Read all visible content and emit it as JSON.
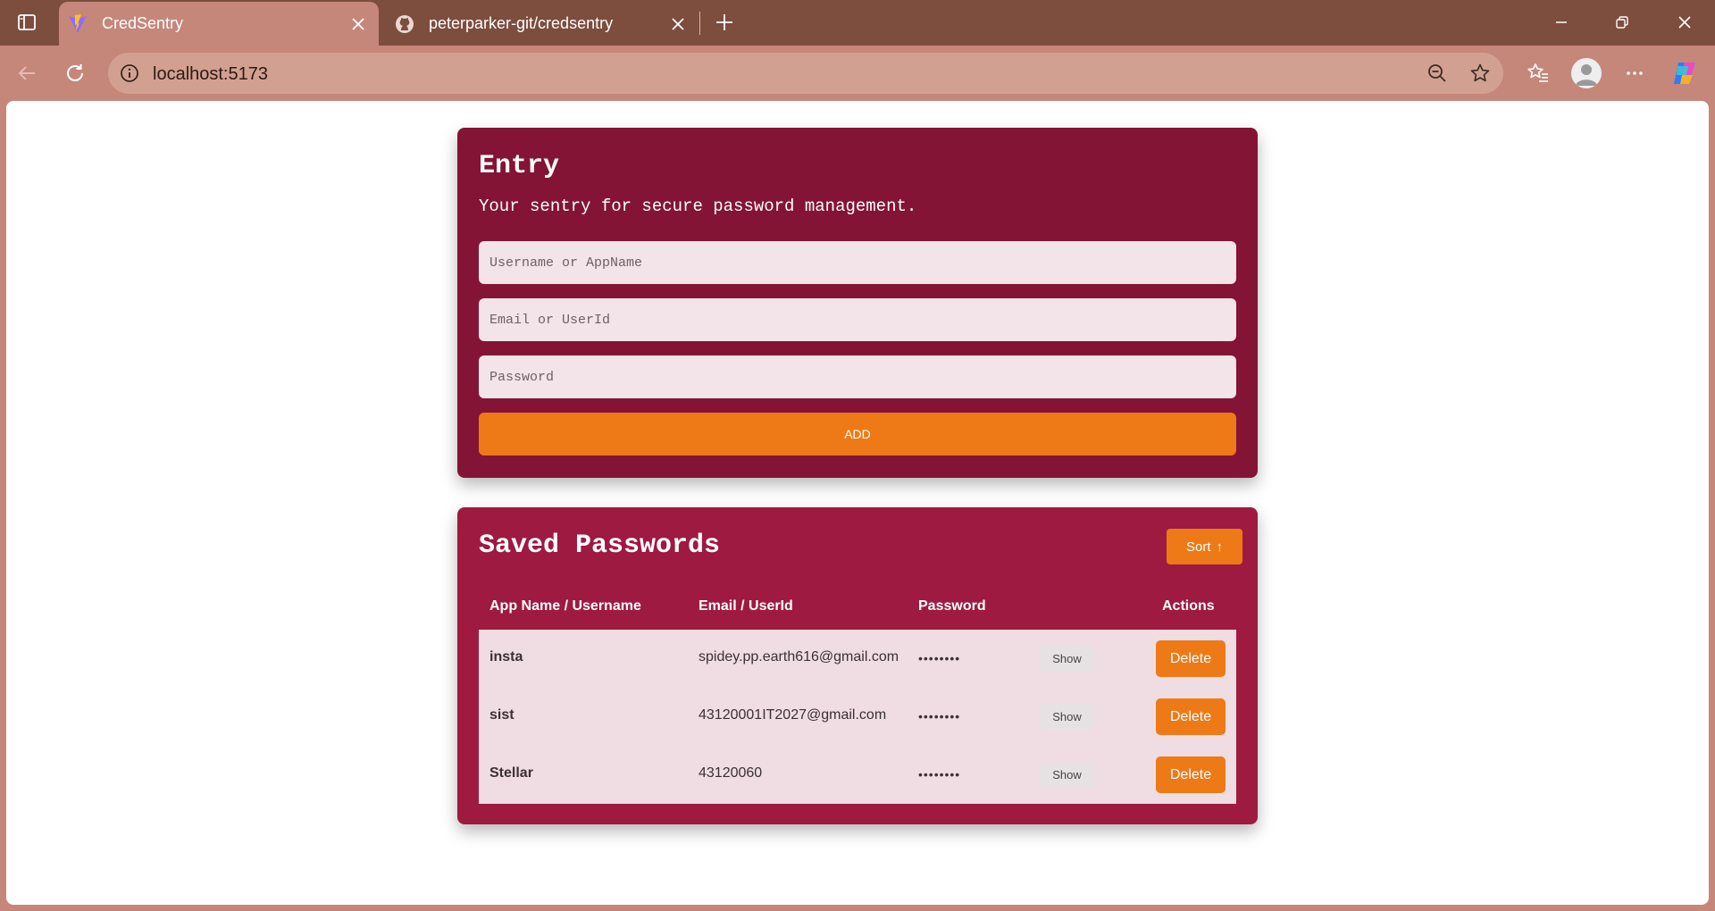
{
  "browser": {
    "tabs": [
      {
        "title": "CredSentry",
        "active": true,
        "favicon": "vite-logo-icon"
      },
      {
        "title": "peterparker-git/credsentry",
        "active": false,
        "favicon": "github-icon"
      }
    ],
    "address": "localhost:5173",
    "theme_colors": {
      "tabbar": "#7d4d3d",
      "toolbar": "#c5877a",
      "omnibox": "#d2a090"
    }
  },
  "entry": {
    "title": "Entry",
    "tagline": "Your sentry for secure password management.",
    "username_placeholder": "Username or AppName",
    "email_placeholder": "Email or UserId",
    "password_placeholder": "Password",
    "add_label": "ADD"
  },
  "saved": {
    "title": "Saved Passwords",
    "sort_label": "Sort",
    "sort_arrow": "↑",
    "headers": {
      "app": "App Name / Username",
      "email": "Email / UserId",
      "password": "Password",
      "actions": "Actions"
    },
    "rows": [
      {
        "app": "insta",
        "email": "spidey.pp.earth616@gmail.com",
        "password_mask": "••••••••",
        "show_label": "Show",
        "delete_label": "Delete"
      },
      {
        "app": "sist",
        "email": "43120001IT2027@gmail.com",
        "password_mask": "••••••••",
        "show_label": "Show",
        "delete_label": "Delete"
      },
      {
        "app": "Stellar",
        "email": "43120060",
        "password_mask": "••••••••",
        "show_label": "Show",
        "delete_label": "Delete"
      }
    ]
  },
  "colors": {
    "entry_card": "#831436",
    "saved_card": "#9e1a40",
    "accent_orange": "#ed7a17",
    "row_bg": "#f0dde3"
  }
}
